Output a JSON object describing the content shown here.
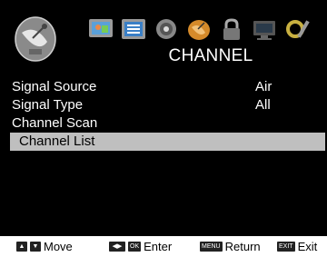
{
  "header": {
    "title": "CHANNEL",
    "icons": [
      "picture-icon",
      "list-icon",
      "sound-icon",
      "channel-satellite-icon",
      "lock-icon",
      "pc-icon",
      "setup-icon"
    ],
    "active_tab": 3
  },
  "menu": {
    "items": [
      {
        "label": "Signal Source",
        "value": "Air"
      },
      {
        "label": "Signal Type",
        "value": "All"
      },
      {
        "label": "Channel Scan",
        "value": ""
      },
      {
        "label": "Channel List",
        "value": ""
      }
    ],
    "selected_index": 3
  },
  "footer": {
    "move": {
      "keys": [
        "▲",
        "▼"
      ],
      "label": "Move"
    },
    "enter": {
      "keys": [
        "◀▶",
        "OK"
      ],
      "label": "Enter"
    },
    "return": {
      "key": "MENU",
      "label": "Return"
    },
    "exit": {
      "key": "EXIT",
      "label": "Exit"
    }
  }
}
